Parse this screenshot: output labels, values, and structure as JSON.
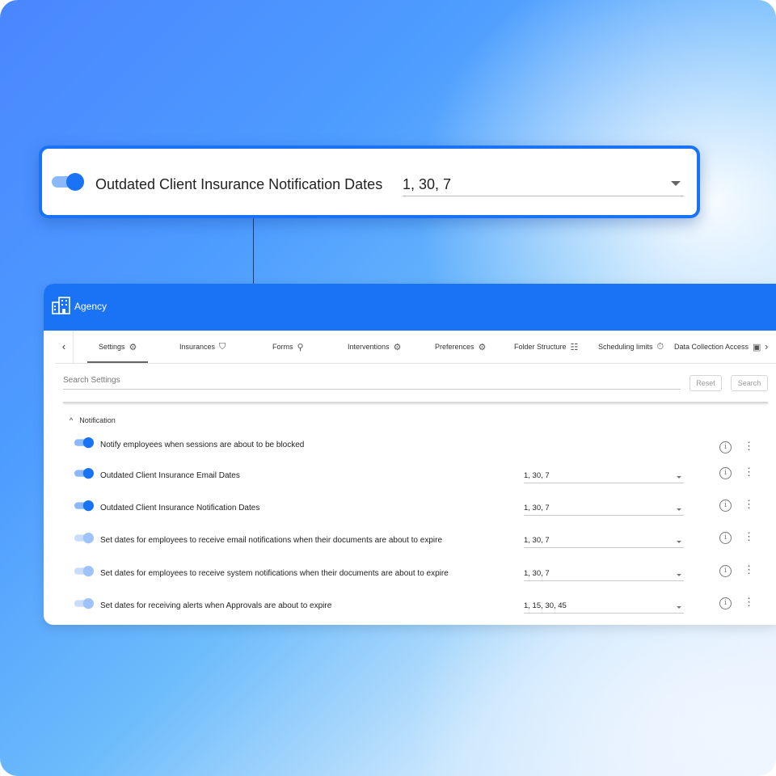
{
  "callout": {
    "label": "Outdated Client Insurance Notification Dates",
    "value": "1, 30, 7"
  },
  "app": {
    "title": "Agency"
  },
  "tabs": [
    {
      "label": "Settings",
      "icon": "gear-icon"
    },
    {
      "label": "Insurances",
      "icon": "shield-icon"
    },
    {
      "label": "Forms",
      "icon": "forms-icon"
    },
    {
      "label": "Interventions",
      "icon": "gear-icon"
    },
    {
      "label": "Preferences",
      "icon": "gear-icon"
    },
    {
      "label": "Folder Structure",
      "icon": "folder-tree-icon"
    },
    {
      "label": "Scheduling limits",
      "icon": "timer-icon"
    },
    {
      "label": "Data Collection Access",
      "icon": "monitor-icon"
    }
  ],
  "search": {
    "placeholder": "Search Settings",
    "reset_label": "Reset",
    "search_label": "Search"
  },
  "section": {
    "title": "Notification"
  },
  "rows": [
    {
      "label": "Notify employees when sessions are about to be blocked",
      "value": ""
    },
    {
      "label": "Outdated Client Insurance Email Dates",
      "value": "1, 30, 7"
    },
    {
      "label": "Outdated Client Insurance Notification Dates",
      "value": "1, 30, 7"
    },
    {
      "label": "Set dates for employees to receive email notifications when their documents are about to expire",
      "value": "1, 30, 7"
    },
    {
      "label": "Set dates for employees to receive system notifications when their documents are about to expire",
      "value": "1, 30, 7"
    },
    {
      "label": "Set dates for receiving alerts when Approvals are about to expire",
      "value": "1, 15, 30, 45"
    }
  ],
  "colors": {
    "primary": "#1a73f5"
  }
}
